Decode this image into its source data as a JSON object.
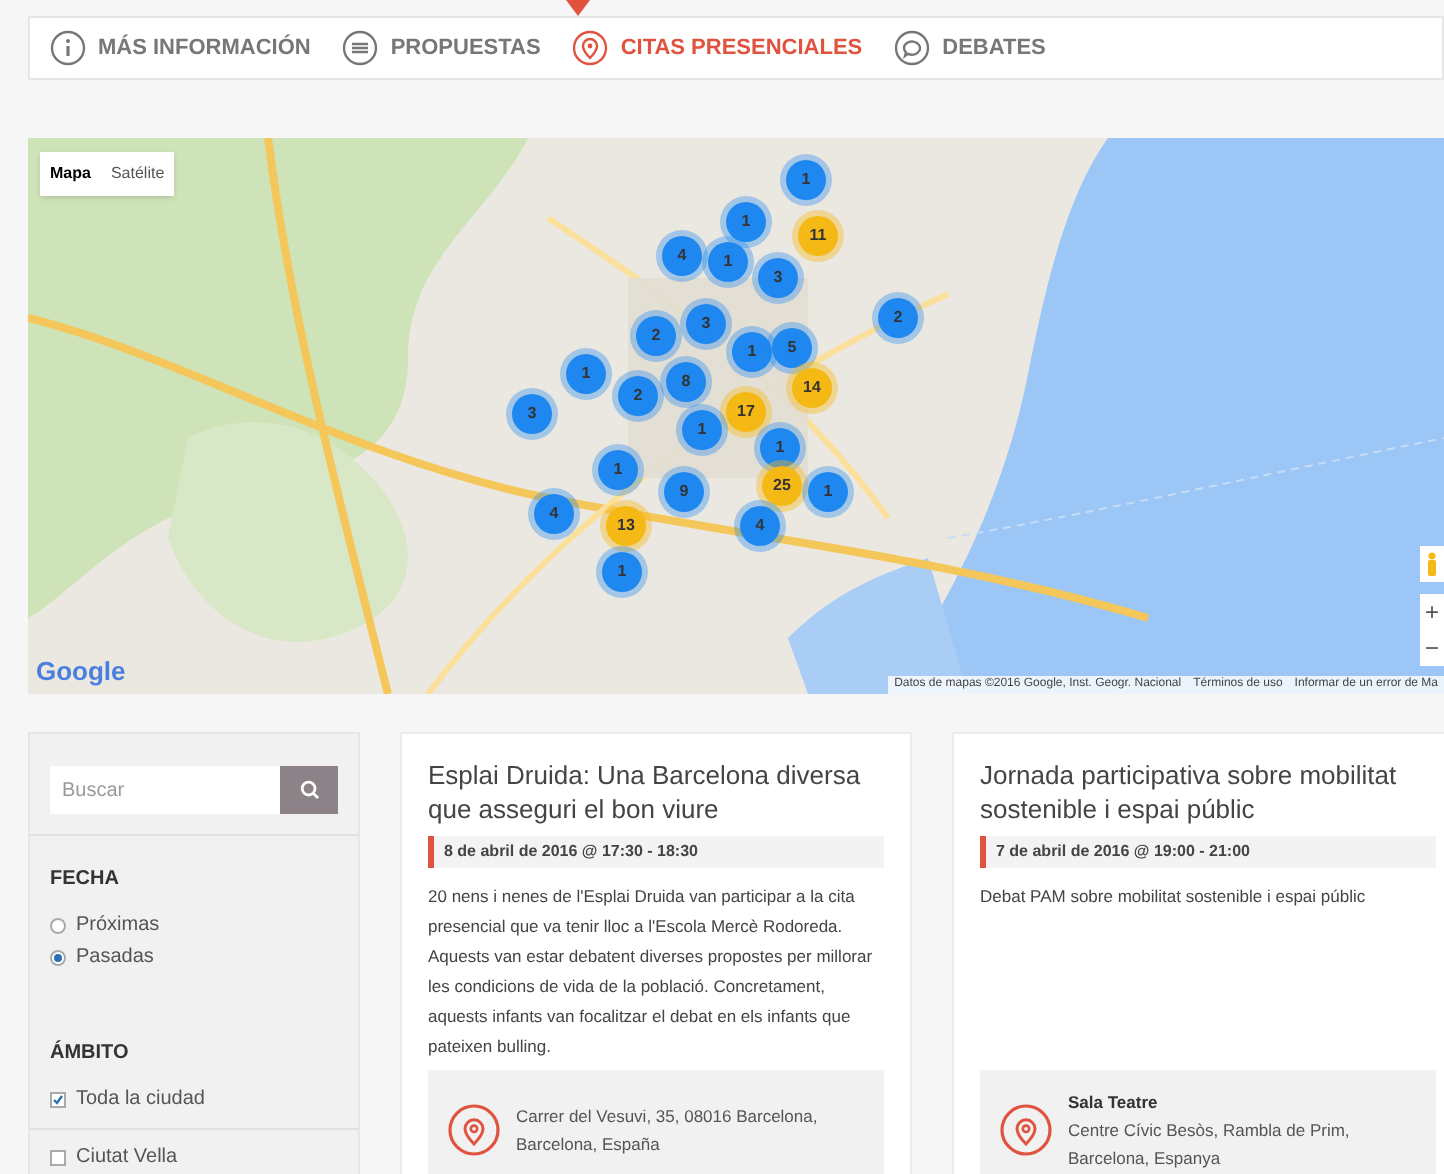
{
  "nav": {
    "items": [
      {
        "label": "MÁS INFORMACIÓN",
        "kind": "info",
        "selected": false
      },
      {
        "label": "PROPUESTAS",
        "kind": "list",
        "selected": false
      },
      {
        "label": "CITAS PRESENCIALES",
        "kind": "pin",
        "selected": true
      },
      {
        "label": "DEBATES",
        "kind": "chat",
        "selected": false
      }
    ]
  },
  "map": {
    "map_types": [
      {
        "label": "Mapa",
        "selected": true
      },
      {
        "label": "Satélite",
        "selected": false
      }
    ],
    "markers": [
      {
        "count": "1",
        "kind": "small"
      },
      {
        "count": "1",
        "kind": "small"
      },
      {
        "count": "11",
        "kind": "large"
      },
      {
        "count": "4",
        "kind": "small"
      },
      {
        "count": "1",
        "kind": "small"
      },
      {
        "count": "3",
        "kind": "small"
      },
      {
        "count": "2",
        "kind": "small"
      },
      {
        "count": "3",
        "kind": "small"
      },
      {
        "count": "2",
        "kind": "small"
      },
      {
        "count": "1",
        "kind": "small"
      },
      {
        "count": "5",
        "kind": "small"
      },
      {
        "count": "1",
        "kind": "small"
      },
      {
        "count": "2",
        "kind": "small"
      },
      {
        "count": "8",
        "kind": "small"
      },
      {
        "count": "14",
        "kind": "large"
      },
      {
        "count": "3",
        "kind": "small"
      },
      {
        "count": "17",
        "kind": "large"
      },
      {
        "count": "1",
        "kind": "small"
      },
      {
        "count": "1",
        "kind": "small"
      },
      {
        "count": "1",
        "kind": "small"
      },
      {
        "count": "9",
        "kind": "small"
      },
      {
        "count": "25",
        "kind": "large"
      },
      {
        "count": "1",
        "kind": "small"
      },
      {
        "count": "4",
        "kind": "small"
      },
      {
        "count": "13",
        "kind": "large"
      },
      {
        "count": "4",
        "kind": "small"
      },
      {
        "count": "1",
        "kind": "small"
      }
    ],
    "logo": "Google",
    "attribution": [
      "Datos de mapas ©2016 Google, Inst. Geogr. Nacional",
      "Términos de uso",
      "Informar de un error de Ma"
    ],
    "zoom_in": "+",
    "zoom_out": "−"
  },
  "sidebar": {
    "search": {
      "placeholder": "Buscar"
    },
    "filters": [
      {
        "title": "FECHA",
        "options": [
          {
            "label": "Próximas",
            "kind": "radio",
            "selected": false
          },
          {
            "label": "Pasadas",
            "kind": "radio",
            "selected": true
          }
        ]
      },
      {
        "title": "ÁMBITO",
        "options": [
          {
            "label": "Toda la ciudad",
            "kind": "checkbox",
            "checked": true
          }
        ]
      },
      {
        "options": [
          {
            "label": "Ciutat Vella",
            "kind": "checkbox",
            "checked": false
          }
        ]
      }
    ]
  },
  "cards": [
    {
      "title": "Esplai Druida: Una Barcelona diversa que asseguri el bon viure",
      "date": "8 de abril de 2016 @ 17:30 - 18:30",
      "description": "20 nens i nenes de l'Esplai Druida van participar a la cita presencial que va tenir lloc a l'Escola Mercè Rodoreda. Aquests van estar debatent diverses propostes per millorar les condicions de vida de la població. Concretament, aquests infants van focalitzar el debat en els infants que pateixen bulling.",
      "location": {
        "address": "Carrer del Vesuvi, 35, 08016 Barcelona, Barcelona, España"
      }
    },
    {
      "title": "Jornada participativa sobre mobilitat sostenible i espai públic",
      "date": "7 de abril de 2016 @ 19:00 - 21:00",
      "description": "Debat PAM sobre mobilitat sostenible i espai públic",
      "location": {
        "name": "Sala Teatre",
        "address": "Centre Cívic Besòs, Rambla de Prim, Barcelona, Espanya"
      }
    }
  ]
}
